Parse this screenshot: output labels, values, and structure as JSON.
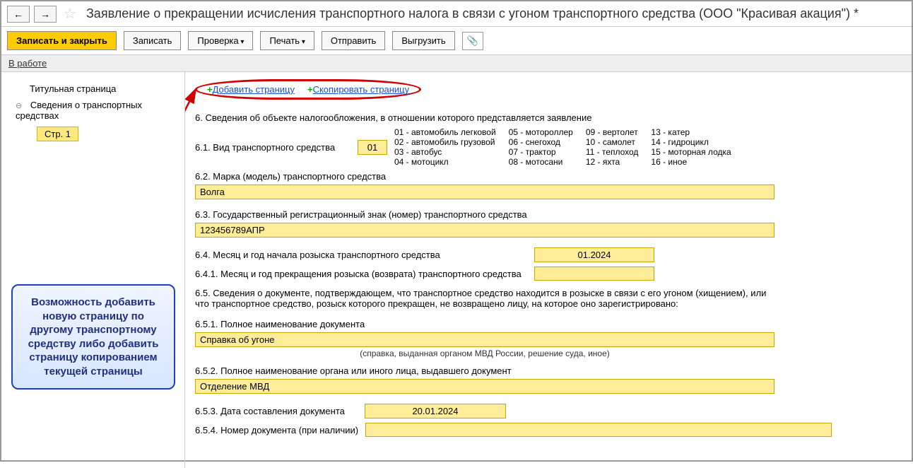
{
  "header": {
    "title": "Заявление о прекращении исчисления транспортного налога в связи с угоном транспортного средства (ООО \"Красивая акация\") *"
  },
  "toolbar": {
    "save_close": "Записать и закрыть",
    "save": "Записать",
    "check": "Проверка",
    "print": "Печать",
    "send": "Отправить",
    "export": "Выгрузить"
  },
  "status": {
    "label": "В работе"
  },
  "sidebar": {
    "title_page": "Титульная страница",
    "section": "Сведения о транспортных средствах",
    "page": "Стр. 1"
  },
  "page_actions": {
    "add": "Добавить страницу",
    "copy": "Скопировать страницу"
  },
  "callout": {
    "text": "Возможность добавить новую страницу по другому транспортному средству либо добавить страницу копированием текущей страницы"
  },
  "form": {
    "section6": "6. Сведения об объекте налогообложения, в отношении которого представляется заявление",
    "f61_label": "6.1. Вид транспортного средства",
    "f61_value": "01",
    "codes": {
      "c01": "01 - автомобиль легковой",
      "c02": "02 - автомобиль грузовой",
      "c03": "03 - автобус",
      "c04": "04 - мотоцикл",
      "c05": "05 - мотороллер",
      "c06": "06 - снегоход",
      "c07": "07 - трактор",
      "c08": "08 - мотосани",
      "c09": "09 - вертолет",
      "c10": "10 - самолет",
      "c11": "11 - теплоход",
      "c12": "12 - яхта",
      "c13": "13 - катер",
      "c14": "14 - гидроцикл",
      "c15": "15 - моторная лодка",
      "c16": "16 - иное"
    },
    "f62_label": "6.2. Марка (модель) транспортного средства",
    "f62_value": "Волга",
    "f63_label": "6.3. Государственный регистрационный знак (номер) транспортного средства",
    "f63_value": "123456789АПР",
    "f64_label": "6.4. Месяц и год начала розыска транспортного средства",
    "f64_value": "01.2024",
    "f641_label": "6.4.1. Месяц и год прекращения розыска (возврата) транспортного средства",
    "f641_value": "",
    "f65_label": "6.5. Сведения о документе, подтверждающем, что транспортное средство находится в розыске в связи с его угоном (хищением), или что транспортное средство, розыск которого прекращен, не возвращено лицу, на которое оно зарегистрировано:",
    "f651_label": "6.5.1. Полное наименование документа",
    "f651_value": "Справка об угоне",
    "f651_hint": "(справка, выданная органом МВД России, решение суда, иное)",
    "f652_label": "6.5.2. Полное наименование органа или иного лица, выдавшего документ",
    "f652_value": "Отделение МВД",
    "f653_label": "6.5.3. Дата составления документа",
    "f653_value": "20.01.2024",
    "f654_label": "6.5.4. Номер документа (при наличии)",
    "f654_value": ""
  }
}
